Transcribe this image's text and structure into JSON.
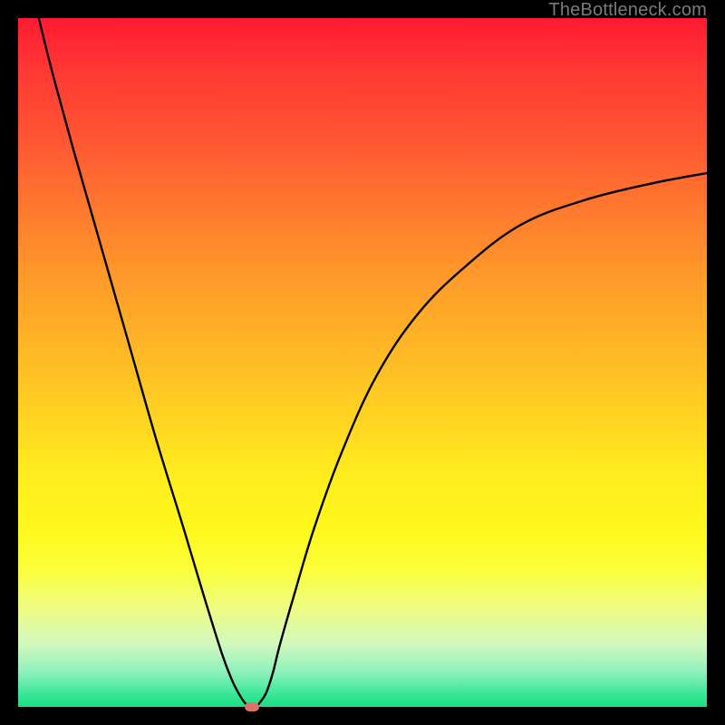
{
  "watermark": "TheBottleneck.com",
  "chart_data": {
    "type": "line",
    "title": "",
    "xlabel": "",
    "ylabel": "",
    "xlim": [
      0,
      100
    ],
    "ylim": [
      0,
      100
    ],
    "background": "rainbow-gradient-red-to-green-vertical",
    "series": [
      {
        "name": "bottleneck-curve",
        "x": [
          3,
          5,
          8,
          12,
          16,
          20,
          24,
          27,
          29.5,
          31,
          32,
          33,
          34,
          34.5,
          35,
          36,
          37,
          38,
          40,
          43,
          47,
          52,
          58,
          65,
          73,
          82,
          92,
          100
        ],
        "y": [
          100,
          92,
          81,
          67,
          53,
          39,
          26,
          16,
          8,
          4,
          2,
          0.5,
          0,
          0,
          0.5,
          2,
          5,
          9,
          16,
          26,
          37,
          48,
          57,
          64,
          70,
          73.5,
          76,
          77.5
        ]
      }
    ],
    "marker": {
      "x": 34,
      "y": 0,
      "color": "#e0706a"
    },
    "colors": {
      "top": "#ff1a33",
      "mid": "#ffd322",
      "bottom": "#18e07f",
      "frame": "#000000",
      "curve": "#000000"
    }
  }
}
